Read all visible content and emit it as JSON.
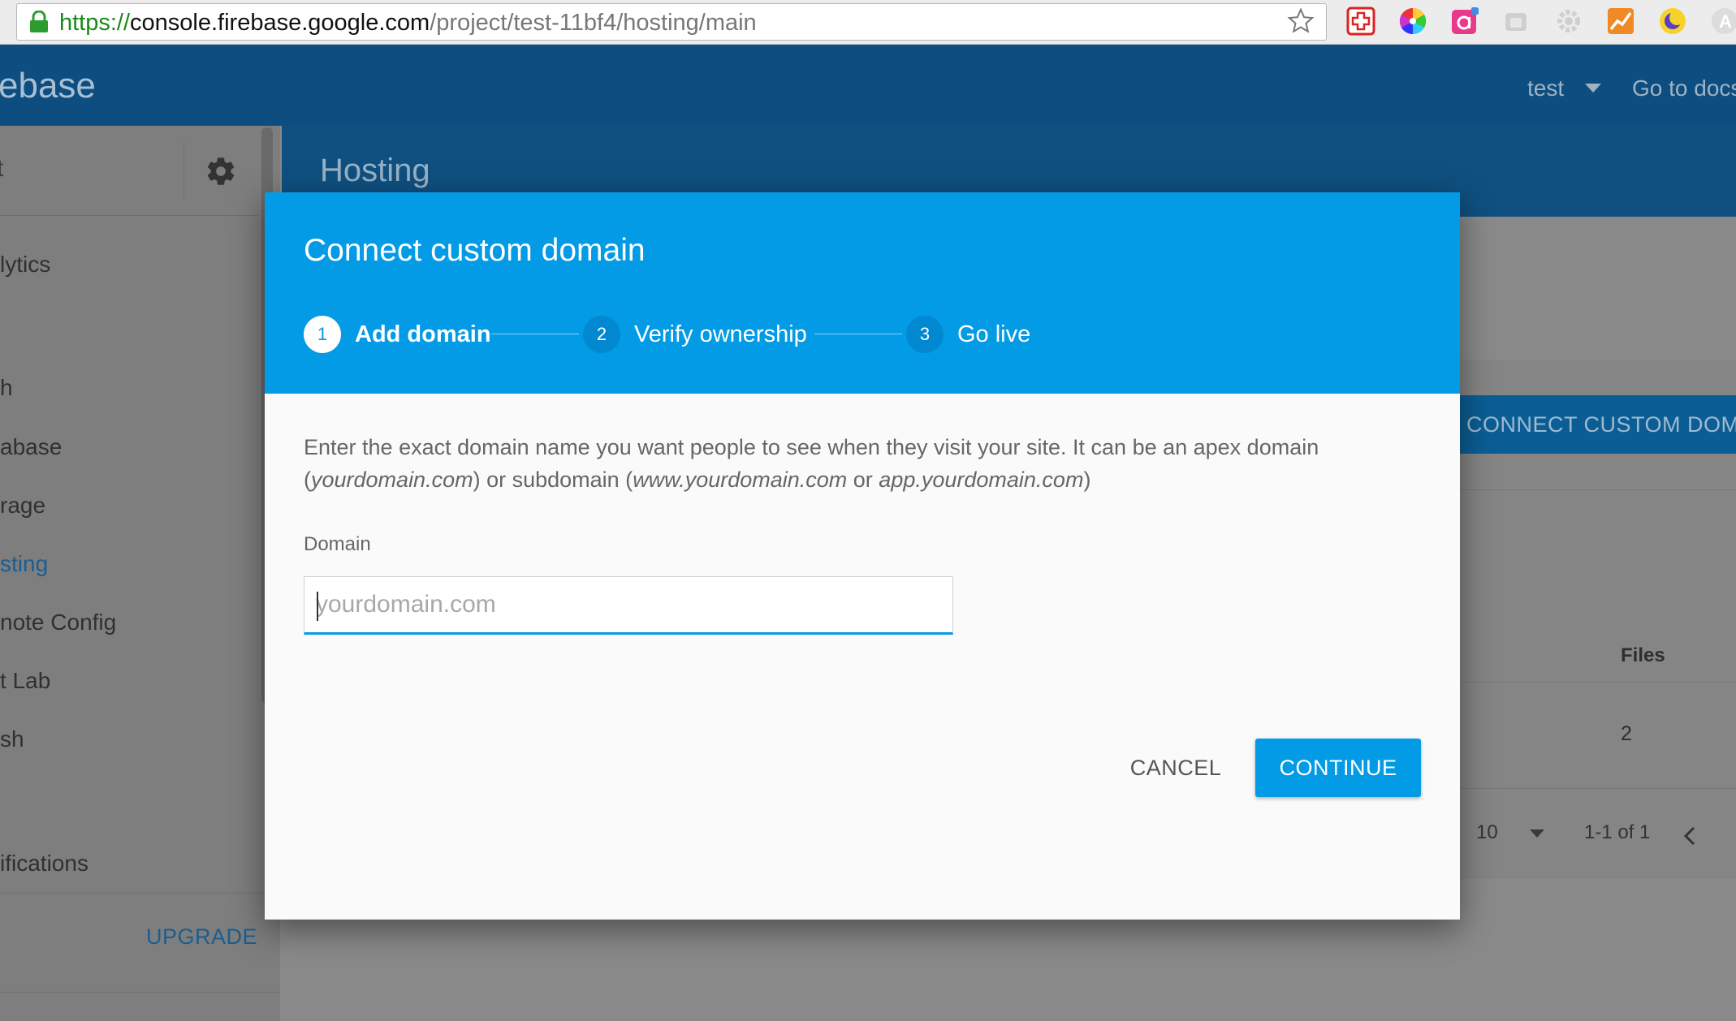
{
  "browser": {
    "url_scheme": "https://",
    "url_host": "console.firebase.google.com",
    "url_path": "/project/test-11bf4/hosting/main",
    "extensions": [
      "first-aid-extension-icon",
      "color-wheel-extension-icon",
      "pink-a-extension-icon",
      "grey-extension-icon",
      "settings-extension-icon",
      "chart-extension-icon",
      "moon-extension-icon",
      "letter-a-extension-icon"
    ]
  },
  "app": {
    "logo_fragment": "ebase",
    "project_name": "test",
    "docs_link": "Go to docs",
    "sidebar": {
      "top_fragment": "t",
      "items": [
        {
          "label": "lytics",
          "active": false
        },
        {
          "label": "h",
          "active": false
        },
        {
          "label": "abase",
          "active": false
        },
        {
          "label": "rage",
          "active": false
        },
        {
          "label": "sting",
          "active": true
        },
        {
          "label": "note Config",
          "active": false
        },
        {
          "label": "t Lab",
          "active": false
        },
        {
          "label": "sh",
          "active": false
        },
        {
          "label": "ifications",
          "active": false
        }
      ],
      "upgrade_label": "UPGRADE"
    },
    "page_title": "Hosting",
    "connect_button_label": "CONNECT CUSTOM DOMA",
    "table": {
      "files_header": "Files",
      "files_value": "2",
      "rows_per_page": "10",
      "range": "1-1 of 1"
    }
  },
  "dialog": {
    "title": "Connect custom domain",
    "steps": [
      {
        "number": "1",
        "label": "Add domain",
        "state": "current"
      },
      {
        "number": "2",
        "label": "Verify ownership",
        "state": "pending"
      },
      {
        "number": "3",
        "label": "Go live",
        "state": "pending"
      }
    ],
    "description": {
      "part1": "Enter the exact domain name you want people to see when they visit your site. It can be an apex domain (",
      "apex_example": "yourdomain.com",
      "part2": ") or subdomain (",
      "sub_example_1": "www.yourdomain.com",
      "part3": " or ",
      "sub_example_2": "app.yourdomain.com",
      "part4": ")"
    },
    "field_label": "Domain",
    "field_placeholder": "yourdomain.com",
    "field_value": "",
    "cancel_label": "CANCEL",
    "continue_label": "CONTINUE"
  },
  "colors": {
    "accent": "#039be5",
    "header_dark": "#0d4d7f"
  }
}
